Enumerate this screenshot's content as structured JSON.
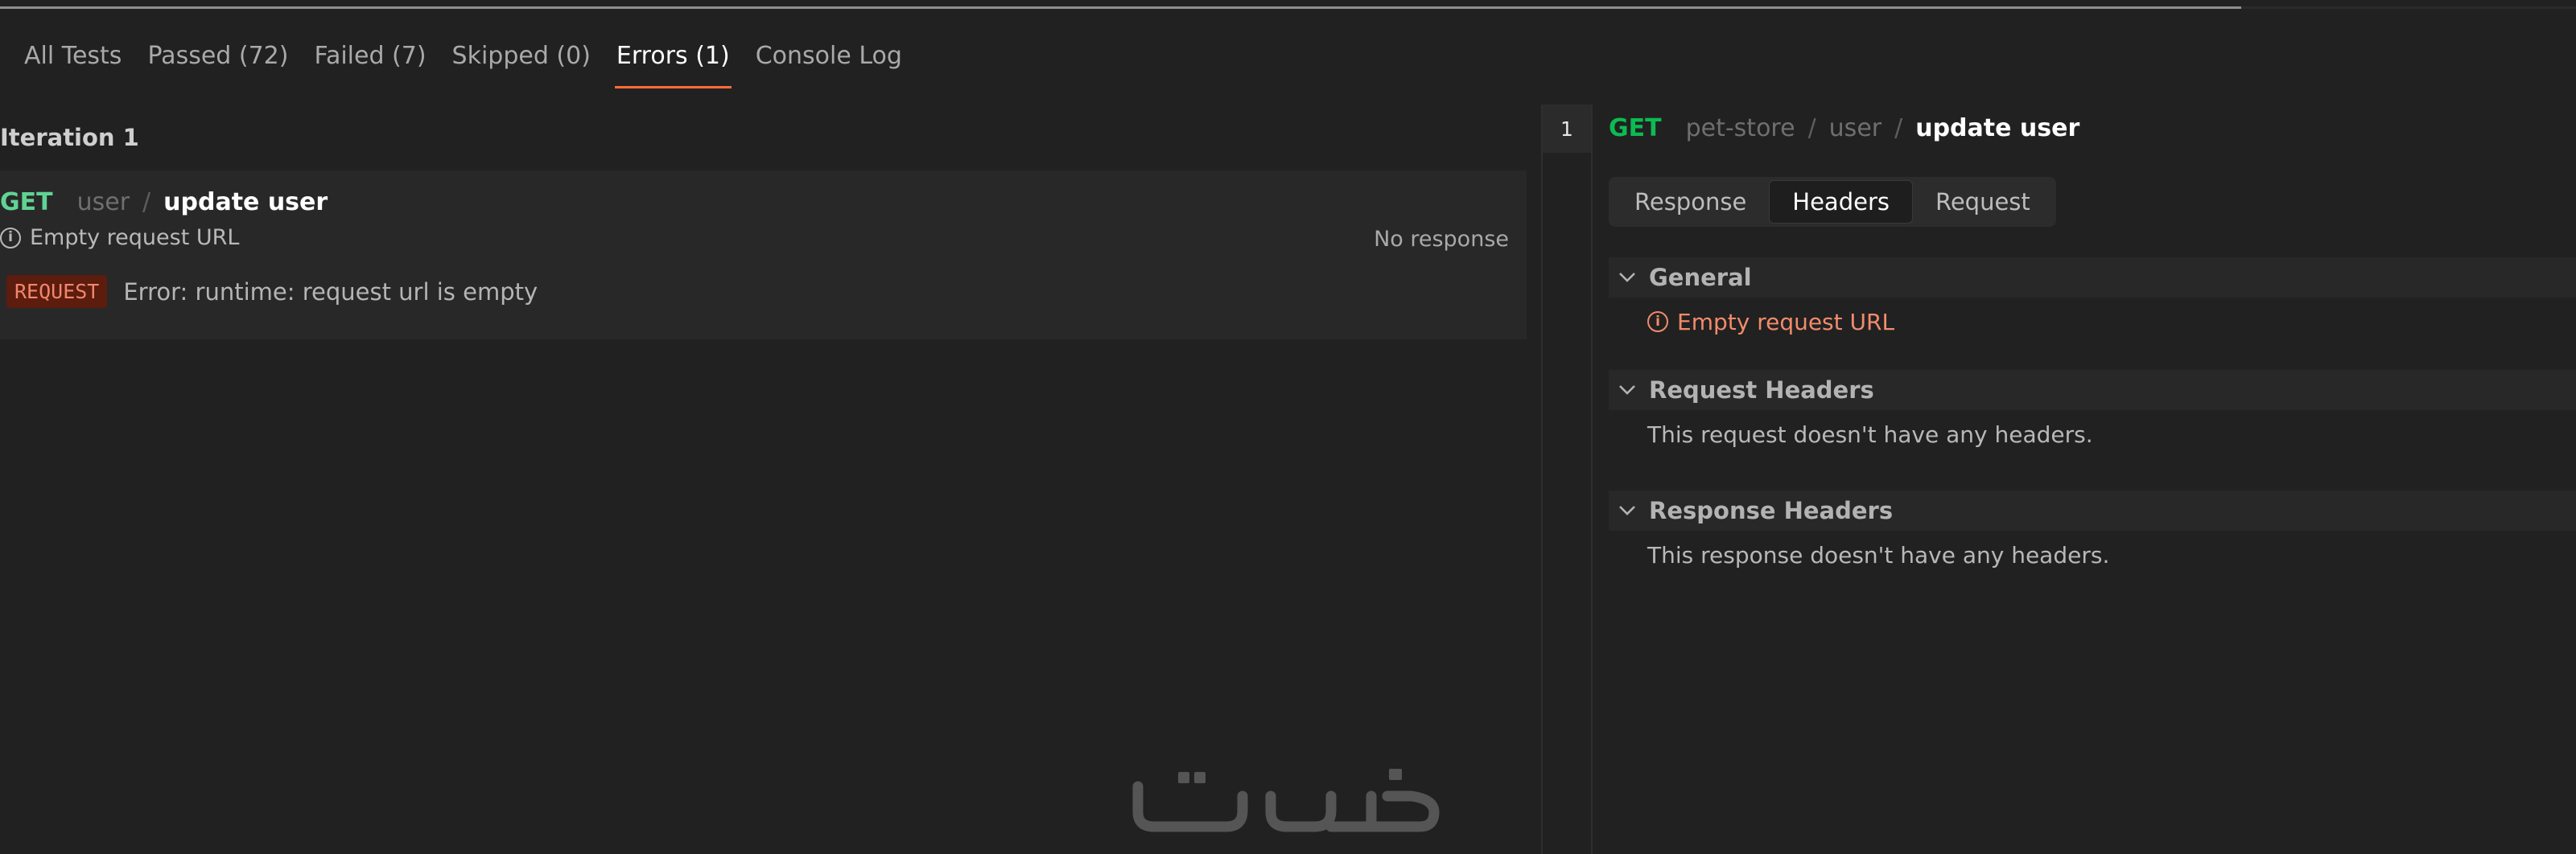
{
  "progress": {
    "fill_fraction": 0.87
  },
  "tabs": [
    {
      "label": "All Tests",
      "active": false
    },
    {
      "label": "Passed (72)",
      "active": false
    },
    {
      "label": "Failed (7)",
      "active": false
    },
    {
      "label": "Skipped (0)",
      "active": false
    },
    {
      "label": "Errors (1)",
      "active": true
    },
    {
      "label": "Console Log",
      "active": false
    }
  ],
  "left": {
    "iteration_label": "Iteration 1",
    "result": {
      "method": "GET",
      "folder": "user",
      "separator": "/",
      "name": "update user",
      "sub_message": "Empty request URL",
      "status": "No response",
      "badge": "REQUEST",
      "error": "Error: runtime: request url is empty"
    }
  },
  "right": {
    "line_number": "1",
    "method": "GET",
    "collection": "pet-store",
    "folder": "user",
    "separator": "/",
    "name": "update user",
    "view_tabs": [
      {
        "label": "Response",
        "active": false
      },
      {
        "label": "Headers",
        "active": true
      },
      {
        "label": "Request",
        "active": false
      }
    ],
    "sections": {
      "general": {
        "title": "General",
        "message": "Empty request URL"
      },
      "request_headers": {
        "title": "Request Headers",
        "message": "This request doesn't have any headers."
      },
      "response_headers": {
        "title": "Response Headers",
        "message": "This response doesn't have any headers."
      }
    }
  },
  "colors": {
    "accent": "#ff6c37",
    "get": "#0cbb52",
    "error_text": "#f28b6c",
    "badge_bg": "#5c1c0e"
  },
  "watermark": {
    "text": "خدسات"
  }
}
